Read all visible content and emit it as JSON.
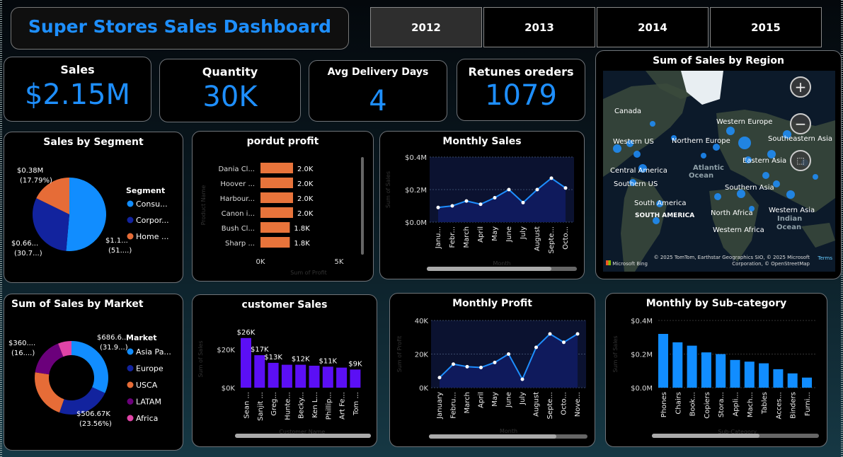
{
  "dashboard_title": "Super Stores Sales Dashboard",
  "years": [
    "2012",
    "2013",
    "2014",
    "2015"
  ],
  "selected_year": "2012",
  "kpis": {
    "sales": {
      "label": "Sales",
      "value": "$2.15M"
    },
    "quantity": {
      "label": "Quantity",
      "value": "30K"
    },
    "delivery": {
      "label": "Avg Delivery Days",
      "value": "4"
    },
    "returns": {
      "label": "Retunes oreders",
      "value": "1079"
    }
  },
  "map": {
    "title": "Sum of Sales by Region",
    "labels": [
      "Canada",
      "Western Europe",
      "Southeastern Asia",
      "Western US",
      "Northern Europe",
      "Eastern Asia",
      "Central America",
      "Southern US",
      "Southern Asia",
      "South America",
      "North Africa",
      "Western Asia",
      "Western Africa",
      "Atlantic",
      "Ocean",
      "SOUTH AMERICA",
      "Indian",
      "Ocean"
    ],
    "attribution": "© 2025 TomTom, Earthstar Geographics SIO, © 2025 Microsoft Corporation, © OpenStreetMap",
    "terms": "Terms",
    "brand": "Microsoft Bing",
    "zoom_in": "+",
    "zoom_out": "−"
  },
  "colors": {
    "accent": "#1e8fff",
    "bar_orange": "#e8743b",
    "bar_purple": "#5b0ff5",
    "consumer": "#118dff",
    "corporate": "#12239e",
    "home": "#e66c37",
    "latam": "#6b007b",
    "africa": "#e044a7",
    "area_fill": "#0f1a5c"
  },
  "chart_data": [
    {
      "type": "pie",
      "title": "Sales by Segment",
      "legend_title": "Segment",
      "legend": [
        "Consu...",
        "Corpor...",
        "Home ..."
      ],
      "values": [
        1.1,
        0.66,
        0.38
      ],
      "unit": "$M",
      "data_labels": [
        [
          "$1.1...",
          "(51....)"
        ],
        [
          "$0.66...",
          "(30.7...)"
        ],
        [
          "$0.38M",
          "(17.79%)"
        ]
      ]
    },
    {
      "type": "bar",
      "orientation": "horizontal",
      "title": "pordut profit",
      "categories": [
        "Dania Cl...",
        "Hoover ...",
        "Harbour...",
        "Canon i...",
        "Bush Cl...",
        "Sharp ..."
      ],
      "values": [
        2.0,
        2.0,
        2.0,
        2.0,
        1.8,
        1.8
      ],
      "data_labels": [
        "2.0K",
        "2.0K",
        "2.0K",
        "2.0K",
        "1.8K",
        "1.8K"
      ],
      "xlabel": "Sum of Profit",
      "ylabel": "Product Name",
      "xticks": [
        "0K",
        "5K"
      ],
      "xlim": [
        0,
        5
      ]
    },
    {
      "type": "area",
      "title": "Monthly Sales",
      "x": [
        "Janu...",
        "Febr...",
        "March",
        "April",
        "May",
        "June",
        "July",
        "August",
        "Septe...",
        "Octo..."
      ],
      "values": [
        0.09,
        0.1,
        0.13,
        0.11,
        0.15,
        0.2,
        0.12,
        0.2,
        0.27,
        0.21
      ],
      "xlabel": "Month",
      "ylabel": "Sum of Sales",
      "yticks": [
        "$0.0M",
        "$0.2M",
        "$0.4M"
      ],
      "ylim": [
        0,
        0.4
      ]
    },
    {
      "type": "pie",
      "title": "Sum of Sales by Market",
      "legend_title": "Market",
      "legend": [
        "Asia Pa...",
        "Europe",
        "USCA",
        "LATAM",
        "Africa"
      ],
      "values": [
        686.6,
        506.67,
        476,
        360,
        128
      ],
      "unit": "$K",
      "data_labels": [
        [
          "$686.6...",
          "(31.9...)"
        ],
        [
          "$506.67K",
          "(23.56%)"
        ],
        [
          "$360....",
          "(16....)"
        ]
      ]
    },
    {
      "type": "bar",
      "title": "customer Sales",
      "categories": [
        "Sean ...",
        "Sanjit ...",
        "Greg...",
        "Hunte...",
        "Becky...",
        "Ken L...",
        "Phillip...",
        "Art Fe...",
        "Tom ..."
      ],
      "values": [
        26,
        17,
        13,
        12,
        12,
        11.5,
        11,
        10.5,
        9.5
      ],
      "data_labels": [
        "$26K",
        "$17K",
        "$13K",
        "",
        "$12K",
        "",
        "$11K",
        "",
        "$9K"
      ],
      "xlabel": "Customer Name",
      "ylabel": "Sum of Sales",
      "yticks": [
        "$0K",
        "$20K"
      ],
      "ylim": [
        0,
        30
      ]
    },
    {
      "type": "area",
      "title": "Monthly Profit",
      "x": [
        "January",
        "Febru...",
        "March",
        "April",
        "May",
        "June",
        "July",
        "August",
        "Septe...",
        "Octo...",
        "Nove..."
      ],
      "values": [
        6,
        14,
        12.5,
        12,
        15,
        20,
        5,
        24,
        32,
        27,
        32
      ],
      "xlabel": "Month",
      "ylabel": "Sum of Profit",
      "yticks": [
        "0K",
        "20K",
        "40K"
      ],
      "ylim": [
        0,
        40
      ]
    },
    {
      "type": "bar",
      "title": "Monthly by Sub-category",
      "categories": [
        "Phones",
        "Chairs",
        "Book...",
        "Copiers",
        "Stora...",
        "Appli...",
        "Mach...",
        "Tables",
        "Acces...",
        "Binders",
        "Furni..."
      ],
      "values": [
        0.32,
        0.27,
        0.25,
        0.21,
        0.2,
        0.165,
        0.155,
        0.145,
        0.11,
        0.085,
        0.06
      ],
      "xlabel": "Sub-Category",
      "ylabel": "Sum of Sales",
      "yticks": [
        "$0.0M",
        "$0.2M",
        "$0.4M"
      ],
      "ylim": [
        0,
        0.4
      ]
    }
  ]
}
